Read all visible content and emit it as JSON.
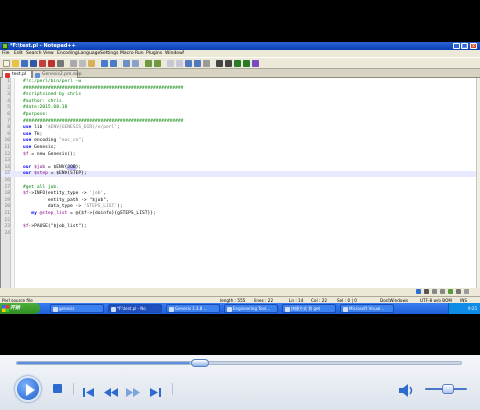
{
  "window": {
    "title": "*F:\\test.pl - Notepad++",
    "min_glyph": "_",
    "max_glyph": "□",
    "close_glyph": "x"
  },
  "menu": [
    "File",
    "Edit",
    "Search",
    "View",
    "Encoding",
    "Language",
    "Settings",
    "Macro",
    "Run",
    "Plugins",
    "Window",
    "?"
  ],
  "tabs": [
    {
      "label": "test.pl",
      "active": true
    },
    {
      "label": "Genesis2.pm.swp",
      "active": false
    }
  ],
  "editor": {
    "current_line": 15,
    "lines": [
      {
        "n": "1",
        "segments": [
          {
            "t": "#!c:/perl/bin/perl -w",
            "c": "comment"
          }
        ]
      },
      {
        "n": "2",
        "segments": [
          {
            "t": "##########################################################",
            "c": "comment"
          }
        ]
      },
      {
        "n": "3",
        "segments": [
          {
            "t": "#scriptsined by chris",
            "c": "comment"
          }
        ]
      },
      {
        "n": "4",
        "segments": [
          {
            "t": "#author: chris",
            "c": "comment"
          }
        ]
      },
      {
        "n": "5",
        "segments": [
          {
            "t": "#date:2015.08.18",
            "c": "comment"
          }
        ]
      },
      {
        "n": "6",
        "segments": [
          {
            "t": "#purpose:",
            "c": "comment"
          }
        ]
      },
      {
        "n": "7",
        "segments": [
          {
            "t": "##########################################################",
            "c": "comment"
          }
        ]
      },
      {
        "n": "8",
        "segments": [
          {
            "t": "use ",
            "c": "keyword"
          },
          {
            "t": "lib ",
            "c": "plain"
          },
          {
            "t": "'$ENV{GENESIS_DIR}/e/perl'",
            "c": "string"
          },
          {
            "t": ";",
            "c": "plain"
          }
        ]
      },
      {
        "n": "9",
        "segments": [
          {
            "t": "use ",
            "c": "keyword"
          },
          {
            "t": "Tk;",
            "c": "plain"
          }
        ]
      },
      {
        "n": "10",
        "segments": [
          {
            "t": "use ",
            "c": "keyword"
          },
          {
            "t": "encoding ",
            "c": "plain"
          },
          {
            "t": "\"euc_cn\"",
            "c": "string"
          },
          {
            "t": ";",
            "c": "plain"
          }
        ]
      },
      {
        "n": "11",
        "segments": [
          {
            "t": "use ",
            "c": "keyword"
          },
          {
            "t": "Genesis;",
            "c": "plain"
          }
        ]
      },
      {
        "n": "12",
        "segments": [
          {
            "t": "$f ",
            "c": "var"
          },
          {
            "t": "= new Genesis();",
            "c": "plain"
          }
        ]
      },
      {
        "n": "13",
        "segments": []
      },
      {
        "n": "14",
        "segments": [
          {
            "t": "our ",
            "c": "keyword"
          },
          {
            "t": "$job ",
            "c": "var"
          },
          {
            "t": "= $ENV{",
            "c": "plain"
          },
          {
            "t": "JOB",
            "c": "hl"
          },
          {
            "t": "};",
            "c": "plain"
          }
        ]
      },
      {
        "n": "15",
        "segments": [
          {
            "t": "our ",
            "c": "keyword"
          },
          {
            "t": "$step ",
            "c": "var"
          },
          {
            "t": "= $ENV{STEP};",
            "c": "plain"
          }
        ]
      },
      {
        "n": "16",
        "segments": []
      },
      {
        "n": "17",
        "segments": [
          {
            "t": "#get all job.",
            "c": "comment"
          }
        ]
      },
      {
        "n": "18",
        "segments": [
          {
            "t": "$f",
            "c": "var"
          },
          {
            "t": "->INFO(entity_type -> ",
            "c": "plain"
          },
          {
            "t": "'job'",
            "c": "string"
          },
          {
            "t": ",",
            "c": "plain"
          }
        ]
      },
      {
        "n": "19",
        "segments": [
          {
            "t": "         entity_path -> \"$job\",",
            "c": "plain"
          }
        ]
      },
      {
        "n": "20",
        "segments": [
          {
            "t": "         data_type -> ",
            "c": "plain"
          },
          {
            "t": "'STEPS_LIST'",
            "c": "string"
          },
          {
            "t": ");",
            "c": "plain"
          }
        ]
      },
      {
        "n": "21",
        "segments": [
          {
            "t": "   my ",
            "c": "keyword"
          },
          {
            "t": "@step_list ",
            "c": "var"
          },
          {
            "t": "= @{$f->{doinfo}{gSTEPS_LIST}};",
            "c": "plain"
          }
        ]
      },
      {
        "n": "22",
        "segments": []
      },
      {
        "n": "23",
        "segments": [
          {
            "t": "$f",
            "c": "var"
          },
          {
            "t": "->PAUSE(\"$job_list\");",
            "c": "plain"
          }
        ]
      },
      {
        "n": "24",
        "segments": []
      }
    ]
  },
  "statusbar": {
    "file_type": "Perl source file",
    "length": "length : 555",
    "lines": "lines : 22",
    "ln": "Ln : 14",
    "col": "Col : 22",
    "sel": "Sel : 0 | 0",
    "eol": "Dos\\Windows",
    "encoding": "UTF-8 w/o BOM",
    "mode": "INS"
  },
  "taskbar": {
    "start_label": "开始",
    "tasks": [
      "genesis",
      "*F:\\test.pl - No",
      "Genesis 1.3.8 ...",
      "Engineering Tool...",
      "快捷方式 到 get",
      "Microsoft Visual..."
    ],
    "clock": "9:25"
  },
  "player": {
    "progress": 0.39,
    "volume": 0.45
  }
}
